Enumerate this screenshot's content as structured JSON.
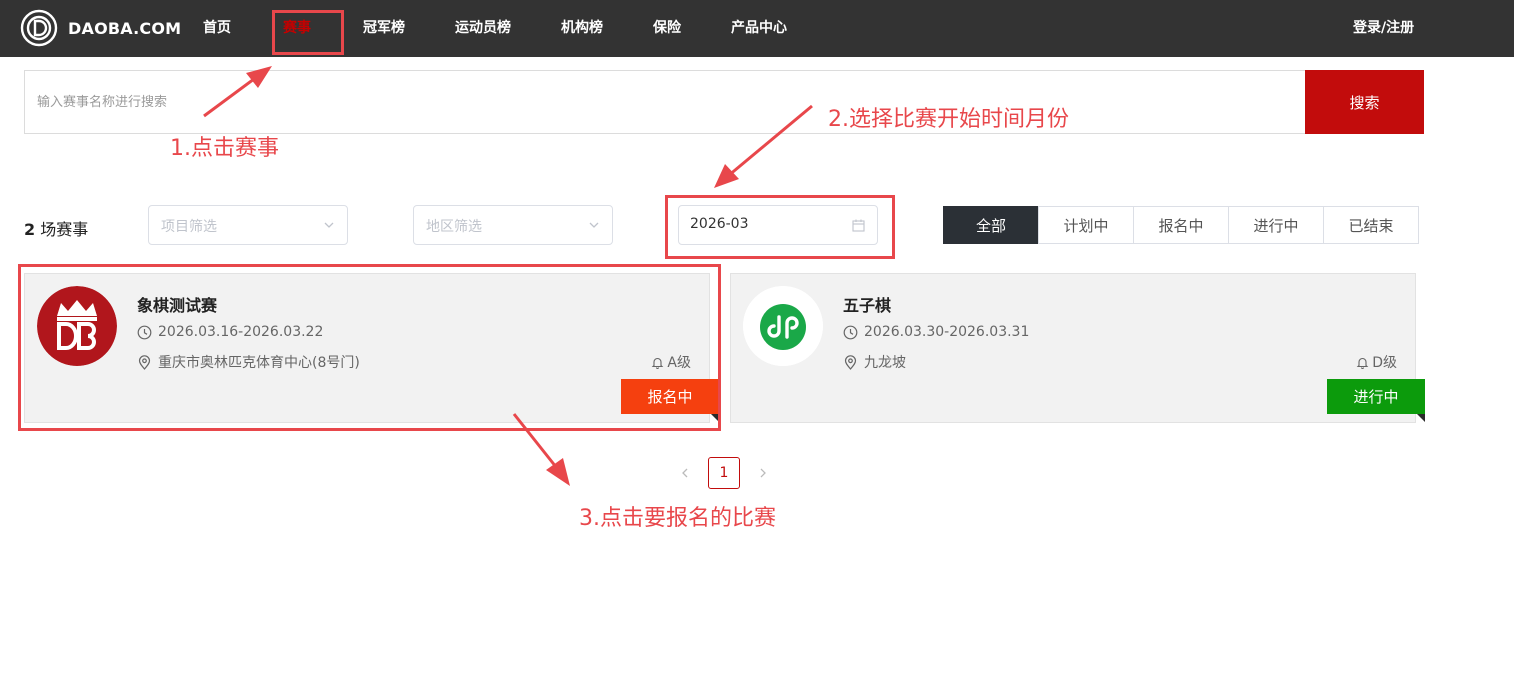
{
  "brand": {
    "name": "DAOBA.COM"
  },
  "nav": {
    "items": [
      {
        "label": "首页"
      },
      {
        "label": "赛事",
        "active": true
      },
      {
        "label": "冠军榜"
      },
      {
        "label": "运动员榜"
      },
      {
        "label": "机构榜"
      },
      {
        "label": "保险"
      },
      {
        "label": "产品中心"
      }
    ],
    "login": "登录/注册"
  },
  "search": {
    "placeholder": "输入赛事名称进行搜索",
    "button": "搜索"
  },
  "filters": {
    "count_number": "2",
    "count_suffix": " 场赛事",
    "project_placeholder": "项目筛选",
    "region_placeholder": "地区筛选",
    "month_value": "2026-03",
    "tabs": [
      {
        "label": "全部",
        "active": true
      },
      {
        "label": "计划中"
      },
      {
        "label": "报名中"
      },
      {
        "label": "进行中"
      },
      {
        "label": "已结束"
      }
    ]
  },
  "events": [
    {
      "title": "象棋测试赛",
      "dates": "2026.03.16-2026.03.22",
      "location": "重庆市奥林匹克体育中心(8号门)",
      "level": "A级",
      "status": "报名中",
      "status_color": "#f5400f",
      "logo": "db-crown-logo"
    },
    {
      "title": "五子棋",
      "dates": "2026.03.30-2026.03.31",
      "location": "九龙坡",
      "level": "D级",
      "status": "进行中",
      "status_color": "#0c9b0c",
      "logo": "mini-program-icon"
    }
  ],
  "pagination": {
    "current": "1"
  },
  "annotations": {
    "step1": "1.点击赛事",
    "step2": "2.选择比赛开始时间月份",
    "step3": "3.点击要报名的比赛",
    "color": "#e8474b"
  },
  "colors": {
    "topbar": "#333333",
    "accent": "#c20c0c",
    "tab_active": "#2b3036"
  }
}
